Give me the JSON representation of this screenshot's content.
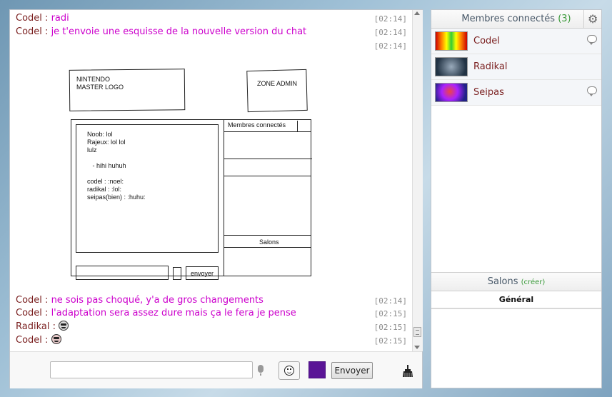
{
  "messages": [
    {
      "user": "Codel",
      "sep": " : ",
      "text": "radi",
      "time": "[02:14]"
    },
    {
      "user": "Codel",
      "sep": " : ",
      "text": "je t'envoie une esquisse de la nouvelle version du chat",
      "time": "[02:14]"
    },
    {
      "time": "[02:14]"
    },
    {
      "user": "Codel",
      "sep": " : ",
      "text": "ne sois pas choqué, y'a de gros changements",
      "time": "[02:14]"
    },
    {
      "user": "Codel",
      "sep": " : ",
      "text": "l'adaptation sera assez dure mais ça le fera je pense",
      "time": "[02:15]"
    },
    {
      "user": "Radikal",
      "sep": " : ",
      "emoticon": "grin-smiley-icon",
      "time": "[02:15]"
    },
    {
      "user": "Codel",
      "sep": " : ",
      "emoticon": "angry-smiley-icon",
      "time": "[02:15]"
    }
  ],
  "sketch": {
    "logo": "NINTENDO\nMASTER LOGO",
    "admin": "ZONE ADMIN",
    "chat_lines": "Noob: lol\nRajeux: lol lol\nlulz\n\n   - hihi huhuh\n\ncodel : :noel:\nradikal : :lol:\nseipas(bien) : :huhu:",
    "members": "Membres connectés",
    "rooms": "Salons",
    "send": "envoyer"
  },
  "input": {
    "value": "",
    "send_label": "Envoyer",
    "color": "#5a1496"
  },
  "sidebar": {
    "title": "Membres connectés",
    "count": "(3)",
    "members": [
      {
        "name": "Codel",
        "has_bubble": true
      },
      {
        "name": "Radikal",
        "has_bubble": false
      },
      {
        "name": "Seipas",
        "has_bubble": true
      }
    ],
    "rooms_title": "Salons",
    "rooms_create": "(créer)",
    "active_room": "Général"
  },
  "colors": {
    "username": "#7a1f1f",
    "message": "#cc00cc",
    "accent_green": "#3a9a3a"
  }
}
